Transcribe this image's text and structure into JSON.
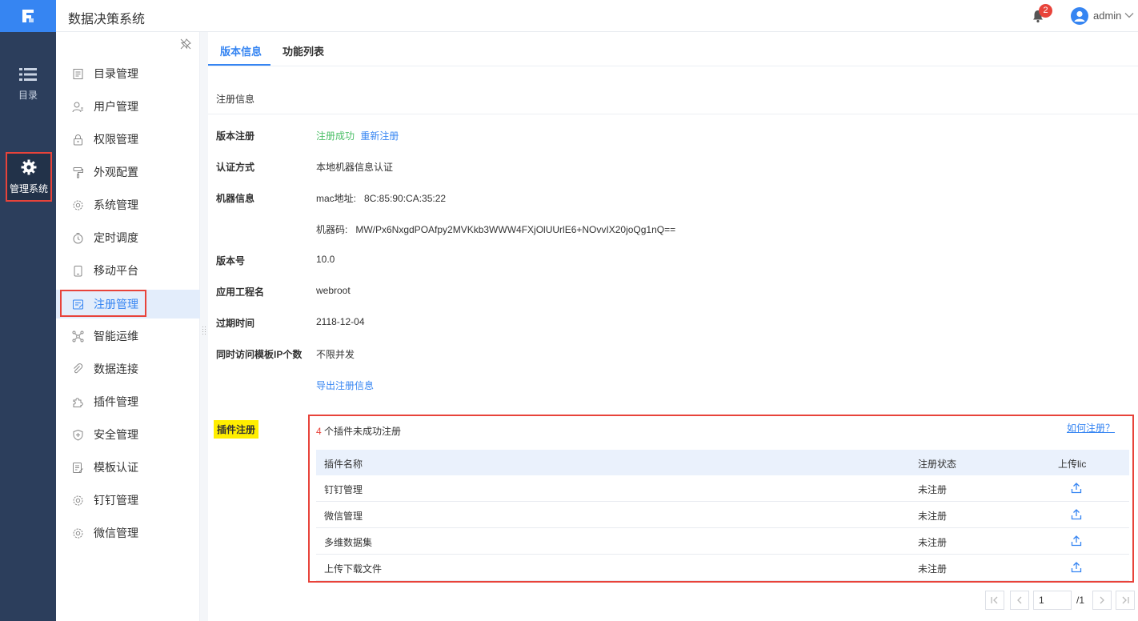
{
  "header": {
    "app_title": "数据决策系统",
    "notification_count": "2",
    "user_name": "admin"
  },
  "leftnav": {
    "catalog_label": "目录",
    "manage_label": "管理系统"
  },
  "submenu": {
    "items": [
      {
        "label": "目录管理",
        "icon": "catalog-icon"
      },
      {
        "label": "用户管理",
        "icon": "user-icon"
      },
      {
        "label": "权限管理",
        "icon": "lock-icon"
      },
      {
        "label": "外观配置",
        "icon": "paint-roller-icon"
      },
      {
        "label": "系统管理",
        "icon": "gear-icon"
      },
      {
        "label": "定时调度",
        "icon": "timer-icon"
      },
      {
        "label": "移动平台",
        "icon": "mobile-icon"
      },
      {
        "label": "注册管理",
        "icon": "register-icon"
      },
      {
        "label": "智能运维",
        "icon": "network-icon"
      },
      {
        "label": "数据连接",
        "icon": "link-icon"
      },
      {
        "label": "插件管理",
        "icon": "puzzle-icon"
      },
      {
        "label": "安全管理",
        "icon": "shield-icon"
      },
      {
        "label": "模板认证",
        "icon": "template-icon"
      },
      {
        "label": "钉钉管理",
        "icon": "gear-icon"
      },
      {
        "label": "微信管理",
        "icon": "gear-icon"
      }
    ],
    "active_index": 7
  },
  "tabs": {
    "version_info": "版本信息",
    "function_list": "功能列表"
  },
  "registration": {
    "section_title": "注册信息",
    "version_register_label": "版本注册",
    "register_status": "注册成功",
    "reregister_link": "重新注册",
    "auth_method_label": "认证方式",
    "auth_method_value": "本地机器信息认证",
    "machine_info_label": "机器信息",
    "mac_address": "mac地址:   8C:85:90:CA:35:22",
    "machine_code": "机器码:   MW/Px6NxgdPOAfpy2MVKkb3WWW4FXjOlUUrlE6+NOvvIX20joQg1nQ==",
    "version_label": "版本号",
    "version_value": "10.0",
    "app_name_label": "应用工程名",
    "app_name_value": "webroot",
    "expire_label": "过期时间",
    "expire_value": "2118-12-04",
    "concurrent_ip_label": "同时访问模板IP个数",
    "concurrent_ip_value": "不限并发",
    "export_link": "导出注册信息"
  },
  "plugins": {
    "section_label": "插件注册",
    "unregistered_count": "4",
    "unregistered_text": " 个插件未成功注册",
    "how_link": "如何注册？",
    "columns": [
      "插件名称",
      "注册状态",
      "上传lic"
    ],
    "rows": [
      {
        "name": "钉钉管理",
        "status": "未注册"
      },
      {
        "name": "微信管理",
        "status": "未注册"
      },
      {
        "name": "多维数据集",
        "status": "未注册"
      },
      {
        "name": "上传下载文件",
        "status": "未注册"
      }
    ]
  },
  "pagination": {
    "current_page": "1",
    "total_pages": "/1"
  }
}
